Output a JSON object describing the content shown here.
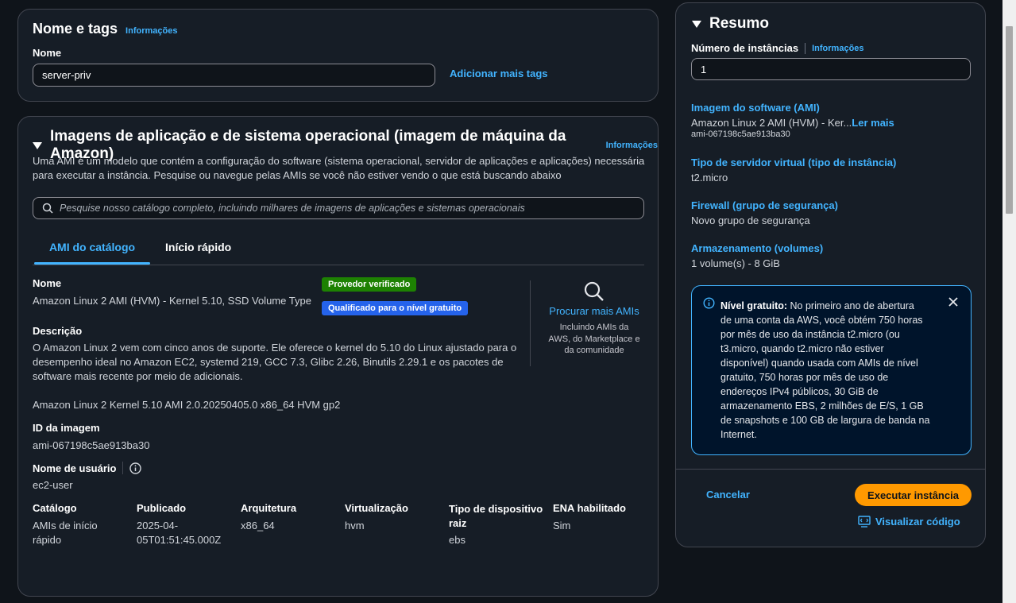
{
  "name_tags": {
    "title": "Nome e tags",
    "info": "Informações",
    "name_label": "Nome",
    "name_value": "server-priv",
    "add_tags": "Adicionar mais tags"
  },
  "ami": {
    "title": "Imagens de aplicação e de sistema operacional (imagem de máquina da Amazon)",
    "info": "Informações",
    "description_line1": "Uma AMI é um modelo que contém a configuração do software (sistema operacional, servidor de aplicações e aplicações) necessária",
    "description_line2": "para executar a instância. Pesquise ou navegue pelas AMIs se você não estiver vendo o que está buscando abaixo",
    "search_placeholder": "Pesquise nosso catálogo completo, incluindo milhares de imagens de aplicações e sistemas operacionais",
    "tabs": [
      {
        "label": "AMI do catálogo",
        "active": true
      },
      {
        "label": "Início rápido",
        "active": false
      }
    ],
    "name_label": "Nome",
    "name_value": "Amazon Linux 2 AMI (HVM) - Kernel 5.10, SSD Volume Type",
    "badge_verified": "Provedor verificado",
    "badge_free": "Qualificado para o nível gratuito",
    "desc_label": "Descrição",
    "desc_line1": "O Amazon Linux 2 vem com cinco anos de suporte. Ele oferece o kernel do 5.10 do Linux ajustado para o",
    "desc_line2": "desempenho ideal no Amazon EC2, systemd 219, GCC 7.3, Glibc 2.26, Binutils 2.29.1 e os pacotes de",
    "desc_line3": "software mais recente por meio de adicionais.",
    "full_name": "Amazon Linux 2 Kernel 5.10 AMI 2.0.20250405.0 x86_64 HVM gp2",
    "image_id_label": "ID da imagem",
    "image_id": "ami-067198c5ae913ba30",
    "username_label": "Nome de usuário",
    "username": "ec2-user",
    "browse_link": "Procurar mais AMIs",
    "browse_sub1": "Incluindo AMIs da",
    "browse_sub2": "AWS, do Marketplace e",
    "browse_sub3": "da comunidade",
    "details": [
      {
        "label": "Catálogo",
        "label2": "",
        "value1": "AMIs de início",
        "value2": "rápido"
      },
      {
        "label": "Publicado",
        "label2": "",
        "value1": "2025-04-",
        "value2": "05T01:51:45.000Z"
      },
      {
        "label": "Arquitetura",
        "label2": "",
        "value1": "x86_64",
        "value2": ""
      },
      {
        "label": "Virtualização",
        "label2": "",
        "value1": "hvm",
        "value2": ""
      },
      {
        "label": "Tipo de dispositivo",
        "label2": "raiz",
        "value1": "ebs",
        "value2": ""
      },
      {
        "label": "ENA habilitado",
        "label2": "",
        "value1": "Sim",
        "value2": ""
      }
    ]
  },
  "summary": {
    "title": "Resumo",
    "instances_label": "Número de instâncias",
    "info": "Informações",
    "instances_value": "1",
    "ami_label": "Imagem do software (AMI)",
    "ami_value": "Amazon Linux 2 AMI (HVM) - Ker...",
    "ami_read_more": "Ler mais",
    "ami_id": "ami-067198c5ae913ba30",
    "type_label": "Tipo de servidor virtual (tipo de instância)",
    "type_value": "t2.micro",
    "firewall_label": "Firewall (grupo de segurança)",
    "firewall_value": "Novo grupo de segurança",
    "storage_label": "Armazenamento (volumes)",
    "storage_value": "1 volume(s) - 8 GiB",
    "free_tier_title": "Nível gratuito:",
    "free_tier_lines": [
      "No primeiro ano de abertura",
      "de uma conta da AWS, você obtém 750 horas",
      "por mês de uso da instância t2.micro (ou",
      "t3.micro, quando t2.micro não estiver",
      "disponível) quando usada com AMIs de nível",
      "gratuito, 750 horas por mês de uso de",
      "endereços IPv4 públicos, 30 GiB de",
      "armazenamento EBS, 2 milhões de E/S, 1 GB",
      "de snapshots e 100 GB de largura de banda na",
      "Internet."
    ],
    "cancel": "Cancelar",
    "launch": "Executar instância",
    "view_code": "Visualizar código"
  },
  "colors": {
    "accent_link": "#42b4ff",
    "launch_button": "#ff9900",
    "badge_green": "#1d8102",
    "badge_blue": "#2563eb"
  }
}
